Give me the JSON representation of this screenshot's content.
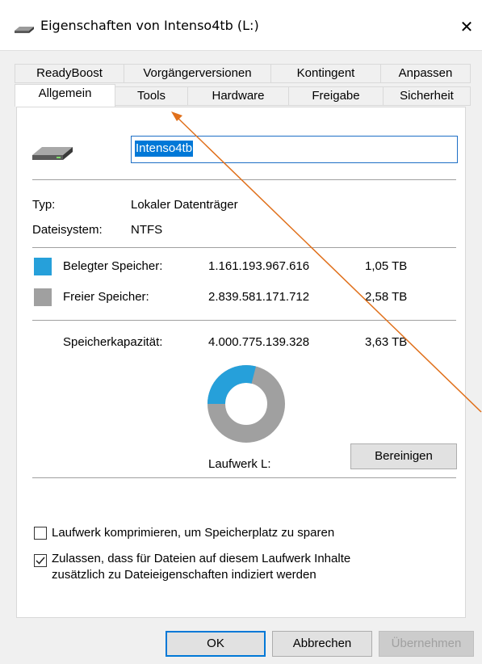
{
  "window": {
    "title": "Eigenschaften von Intenso4tb (L:)",
    "close_label": "✕"
  },
  "tabs_row1": [
    "ReadyBoost",
    "Vorgängerversionen",
    "Kontingent",
    "Anpassen"
  ],
  "tabs_row2": [
    "Allgemein",
    "Tools",
    "Hardware",
    "Freigabe",
    "Sicherheit"
  ],
  "active_tab": "Allgemein",
  "general": {
    "drive_name": "Intenso4tb",
    "type_label": "Typ:",
    "type_value": "Lokaler Datenträger",
    "fs_label": "Dateisystem:",
    "fs_value": "NTFS",
    "used": {
      "label": "Belegter Speicher:",
      "bytes": "1.161.193.967.616",
      "size": "1,05 TB",
      "color": "#26a0da",
      "fraction": 0.29
    },
    "free": {
      "label": "Freier Speicher:",
      "bytes": "2.839.581.171.712",
      "size": "2,58 TB",
      "color": "#a0a0a0"
    },
    "capacity": {
      "label": "Speicherkapazität:",
      "bytes": "4.000.775.139.328",
      "size": "3,63 TB"
    },
    "drive_label": "Laufwerk L:",
    "cleanup_label": "Bereinigen",
    "compress_label": "Laufwerk komprimieren, um Speicherplatz zu sparen",
    "compress_checked": false,
    "index_label_line1": "Zulassen, dass für Dateien auf diesem Laufwerk Inhalte",
    "index_label_line2": "zusätzlich zu Dateieigenschaften indiziert werden",
    "index_checked": true
  },
  "buttons": {
    "ok": "OK",
    "cancel": "Abbrechen",
    "apply": "Übernehmen"
  },
  "annotation_color": "#e0701b"
}
